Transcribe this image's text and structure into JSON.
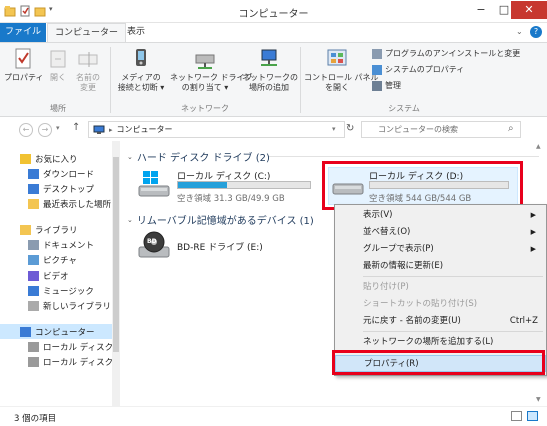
{
  "window": {
    "title": "コンピューター",
    "minimize": "−",
    "maximize": "□",
    "close": "✕"
  },
  "ribbon_tabs": {
    "file": "ファイル",
    "computer": "コンピューター",
    "view": "表示",
    "help": "?"
  },
  "ribbon": {
    "location_group": "場所",
    "properties": "プロパティ",
    "open": "開く",
    "rename": "名前の\n変更",
    "network_group": "ネットワーク",
    "media": "メディアの\n接続と切断 ▾",
    "map_drive": "ネットワーク ドライブ\nの割り当て ▾",
    "add_location": "ネットワークの\n場所の追加",
    "system_group": "システム",
    "control_panel": "コントロール パネル\nを開く",
    "uninstall": "プログラムのアンインストールと変更",
    "sys_props": "システムのプロパティ",
    "manage": "管理"
  },
  "nav": {
    "back": "←",
    "forward": "→",
    "up": "↑",
    "address": "コンピューター",
    "search_placeholder": "コンピューターの検索"
  },
  "sidebar": {
    "items": [
      {
        "label": "お気に入り",
        "icon": "star-icon",
        "level": 0
      },
      {
        "label": "ダウンロード",
        "icon": "download-folder-icon",
        "level": 1
      },
      {
        "label": "デスクトップ",
        "icon": "desktop-icon",
        "level": 1
      },
      {
        "label": "最近表示した場所",
        "icon": "recent-places-icon",
        "level": 1
      },
      {
        "label": "ライブラリ",
        "icon": "library-icon",
        "level": 0
      },
      {
        "label": "ドキュメント",
        "icon": "documents-icon",
        "level": 1
      },
      {
        "label": "ピクチャ",
        "icon": "pictures-icon",
        "level": 1
      },
      {
        "label": "ビデオ",
        "icon": "videos-icon",
        "level": 1
      },
      {
        "label": "ミュージック",
        "icon": "music-icon",
        "level": 1
      },
      {
        "label": "新しいライブラリ",
        "icon": "new-library-icon",
        "level": 1
      },
      {
        "label": "コンピューター",
        "icon": "computer-icon",
        "level": 0
      },
      {
        "label": "ローカル ディスク (C",
        "icon": "drive-c-icon",
        "level": 1
      },
      {
        "label": "ローカル ディスク (D",
        "icon": "drive-d-icon",
        "level": 1
      }
    ]
  },
  "content": {
    "hdd_group": "ハード ディスク ドライブ (2)",
    "removable_group": "リムーバブル記憶域があるデバイス (1)",
    "drive_c": {
      "name": "ローカル ディスク (C:)",
      "free": "空き領域 31.3 GB/49.9 GB",
      "used_fraction": 0.373
    },
    "drive_d": {
      "name": "ローカル ディスク (D:)",
      "free": "空き領域 544 GB/544 GB",
      "used_fraction": 0.0
    },
    "bd_drive": {
      "name": "BD-RE ドライブ (E:)",
      "icon_label": "BD"
    }
  },
  "context_menu": {
    "items": [
      {
        "label": "表示(V)",
        "arrow": "▶"
      },
      {
        "label": "並べ替え(O)",
        "arrow": "▶"
      },
      {
        "label": "グループで表示(P)",
        "arrow": "▶"
      },
      {
        "label": "最新の情報に更新(E)"
      },
      {
        "sep": true
      },
      {
        "label": "貼り付け(P)",
        "disabled": true
      },
      {
        "label": "ショートカットの貼り付け(S)",
        "disabled": true
      },
      {
        "label": "元に戻す - 名前の変更(U)",
        "shortcut": "Ctrl+Z"
      },
      {
        "sep": true
      },
      {
        "label": "ネットワークの場所を追加する(L)"
      },
      {
        "sep": true
      },
      {
        "label": "プロパティ(R)",
        "highlighted": true
      }
    ]
  },
  "status": {
    "count": "3 個の項目"
  },
  "colors": {
    "accent": "#1979ca",
    "highlight_red": "#e8001c",
    "drive_bar": "#26a0da"
  }
}
